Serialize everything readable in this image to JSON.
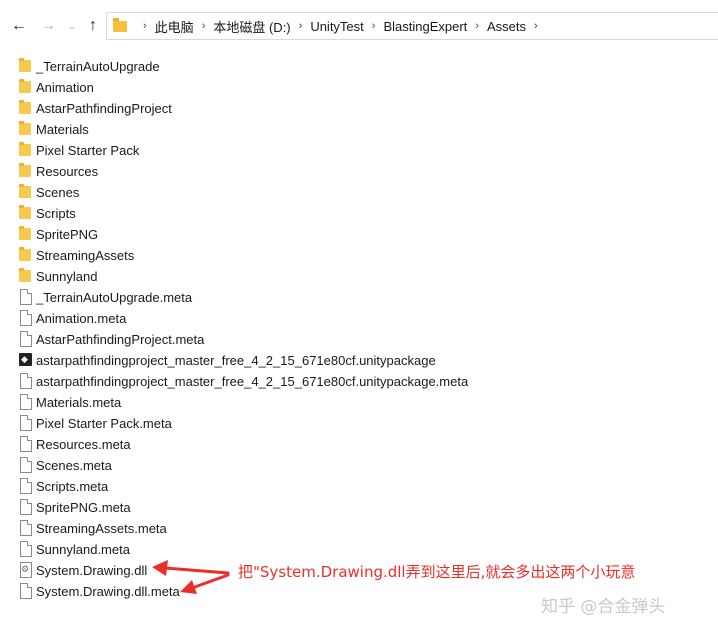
{
  "navigation": {
    "back_icon": "arrow-left-icon",
    "forward_icon": "arrow-right-icon",
    "recent_icon": "chevron-down-icon",
    "up_icon": "arrow-up-icon"
  },
  "address_bar": {
    "folder_icon": "folder-icon",
    "crumbs": [
      "此电脑",
      "本地磁盘 (D:)",
      "UnityTest",
      "BlastingExpert",
      "Assets"
    ]
  },
  "files": [
    {
      "name": "_TerrainAutoUpgrade",
      "type": "folder"
    },
    {
      "name": "Animation",
      "type": "folder"
    },
    {
      "name": "AstarPathfindingProject",
      "type": "folder"
    },
    {
      "name": "Materials",
      "type": "folder"
    },
    {
      "name": "Pixel Starter Pack",
      "type": "folder"
    },
    {
      "name": "Resources",
      "type": "folder"
    },
    {
      "name": "Scenes",
      "type": "folder"
    },
    {
      "name": "Scripts",
      "type": "folder"
    },
    {
      "name": "SpritePNG",
      "type": "folder"
    },
    {
      "name": "StreamingAssets",
      "type": "folder"
    },
    {
      "name": "Sunnyland",
      "type": "folder"
    },
    {
      "name": "_TerrainAutoUpgrade.meta",
      "type": "doc"
    },
    {
      "name": "Animation.meta",
      "type": "doc"
    },
    {
      "name": "AstarPathfindingProject.meta",
      "type": "doc"
    },
    {
      "name": "astarpathfindingproject_master_free_4_2_15_671e80cf.unitypackage",
      "type": "unity"
    },
    {
      "name": "astarpathfindingproject_master_free_4_2_15_671e80cf.unitypackage.meta",
      "type": "doc"
    },
    {
      "name": "Materials.meta",
      "type": "doc"
    },
    {
      "name": "Pixel Starter Pack.meta",
      "type": "doc"
    },
    {
      "name": "Resources.meta",
      "type": "doc"
    },
    {
      "name": "Scenes.meta",
      "type": "doc"
    },
    {
      "name": "Scripts.meta",
      "type": "doc"
    },
    {
      "name": "SpritePNG.meta",
      "type": "doc"
    },
    {
      "name": "StreamingAssets.meta",
      "type": "doc"
    },
    {
      "name": "Sunnyland.meta",
      "type": "doc"
    },
    {
      "name": "System.Drawing.dll",
      "type": "dll"
    },
    {
      "name": "System.Drawing.dll.meta",
      "type": "doc"
    }
  ],
  "annotation": {
    "text": "把\"System.Drawing.dll弄到这里后,就会多出这两个小玩意",
    "color": "#e8302a"
  },
  "watermark": "知乎 @合金弹头"
}
